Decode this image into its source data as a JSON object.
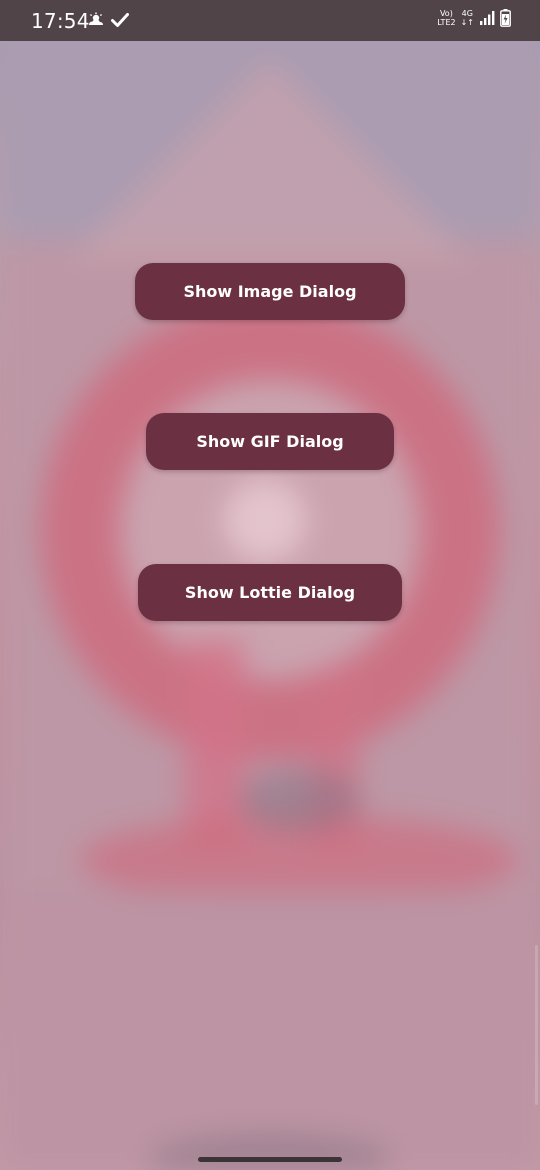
{
  "status_bar": {
    "time": "17:54",
    "left_icons": [
      "weather-cloud-sun-icon",
      "check-icon"
    ],
    "network_top": "Vo)",
    "network_bottom": "LTE2",
    "generation_top": "4G",
    "generation_bottom": "↓↑",
    "right_icons": [
      "signal-icon",
      "battery-charging-icon"
    ]
  },
  "buttons": {
    "image_dialog": "Show Image Dialog",
    "gif_dialog": "Show GIF Dialog",
    "lottie_dialog": "Show Lottie Dialog"
  },
  "colors": {
    "button_bg": "#6b3041",
    "button_text": "#ffffff",
    "status_bar_bg": "#514448",
    "background_tint": "#c58e9c"
  }
}
